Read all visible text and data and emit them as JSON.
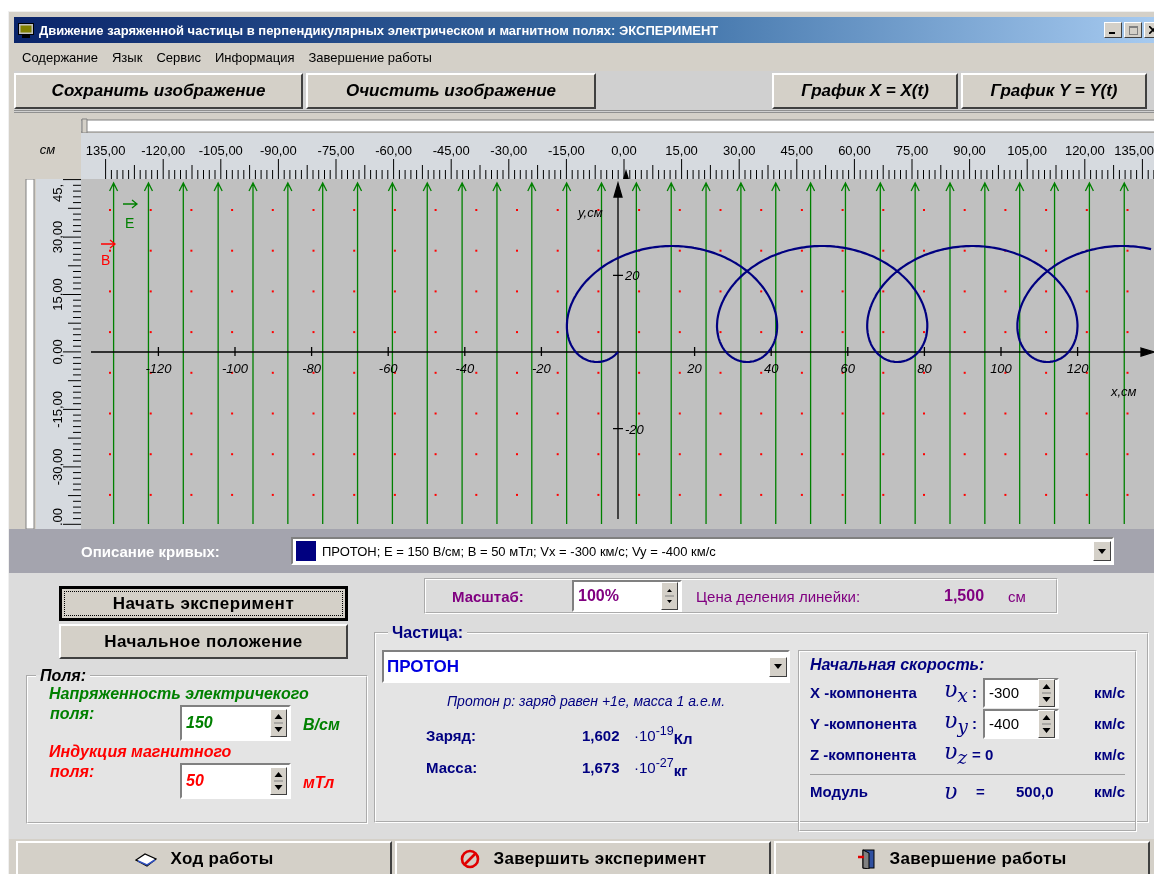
{
  "window": {
    "title": "Движение заряженной частицы в перпендикулярных электрическом и магнитном полях: ЭКСПЕРИМЕНТ"
  },
  "menu": [
    "Содержание",
    "Язык",
    "Сервис",
    "Информация",
    "Завершение работы"
  ],
  "toolbar": {
    "left": [
      "Сохранить изображение",
      "Очистить изображение"
    ],
    "right": [
      "График X = X(t)",
      "График Y = Y(t)"
    ]
  },
  "ruler": {
    "unit": "см",
    "x_labels": [
      "135,00",
      "-120,00",
      "-105,00",
      "-90,00",
      "-75,00",
      "-60,00",
      "-45,00",
      "-30,00",
      "-15,00",
      "0,00",
      "15,00",
      "30,00",
      "45,00",
      "60,00",
      "75,00",
      "90,00",
      "105,00",
      "120,00",
      "135,00"
    ],
    "y_labels": [
      "45,",
      "30,00",
      "15,00",
      "0,00",
      "-15,00",
      "-30,00",
      ".00"
    ]
  },
  "plot": {
    "x_axis": {
      "label": "x,см",
      "ticks": [
        "-120",
        "-100",
        "-80",
        "-60",
        "-40",
        "-20",
        "20",
        "40",
        "60",
        "80",
        "100",
        "120"
      ]
    },
    "y_axis": {
      "label": "y,см",
      "ticks": [
        "20",
        "-20"
      ]
    },
    "fields": [
      {
        "kind": "electric",
        "label": "E"
      },
      {
        "kind": "magnetic",
        "label": "B"
      }
    ]
  },
  "curves": {
    "label": "Описание кривых:",
    "color": "#000080",
    "text": "ПРОТОН; E = 150 В/см; B = 50 мТл; Vx = -300 км/с; Vy = -400 км/с"
  },
  "actions": [
    {
      "label": "Начать эксперимент",
      "focused": true
    },
    {
      "label": "Начальное положение",
      "focused": false
    }
  ],
  "scale": {
    "label": "Масштаб:",
    "value": "100%",
    "division_label": "Цена деления линейки:",
    "division_value": "1,500",
    "division_unit": "см"
  },
  "fields": {
    "title": "Поля:",
    "items": [
      {
        "kind": "electric",
        "label": [
          "Напряженность электричекого",
          "поля:"
        ],
        "value": "150",
        "unit": "В/см"
      },
      {
        "kind": "magnetic",
        "label": [
          "Индукция магнитного",
          "поля:"
        ],
        "value": "50",
        "unit": "мТл"
      }
    ]
  },
  "particle": {
    "title": "Частица:",
    "selected": "ПРОТОН",
    "description": "Протон p: заряд равен +1e, масса 1 а.е.м.",
    "properties": [
      {
        "label": "Заряд:",
        "value": "1,602",
        "power": "·10$^{-19}$",
        "unit": "Кл"
      },
      {
        "label": "Масса:",
        "value": "1,673",
        "power": "·10$^{-27}$",
        "unit": "кг"
      }
    ]
  },
  "velocity": {
    "title": "Начальная скорость:",
    "components": [
      {
        "kind": "spin",
        "label": "X -компонента",
        "symbol": "υ$_{x}$",
        "separator": ":",
        "value": "-300",
        "unit": "км/с"
      },
      {
        "kind": "spin",
        "label": "Y -компонента",
        "symbol": "υ$_{y}$",
        "separator": ":",
        "value": "-400",
        "unit": "км/с"
      },
      {
        "kind": "fixed",
        "label": "Z -компонента",
        "symbol": "υ$_{z}$",
        "separator": "= 0",
        "unit": "км/с"
      }
    ],
    "modulus": {
      "label": "Модуль",
      "symbol": "υ",
      "separator": "=",
      "value": "500,0",
      "unit": "км/с"
    }
  },
  "bottom_buttons": [
    {
      "kind": "book",
      "label": "Ход работы"
    },
    {
      "kind": "stop",
      "label": "Завершить эксперимент"
    },
    {
      "kind": "exit",
      "label": "Завершение работы"
    }
  ]
}
